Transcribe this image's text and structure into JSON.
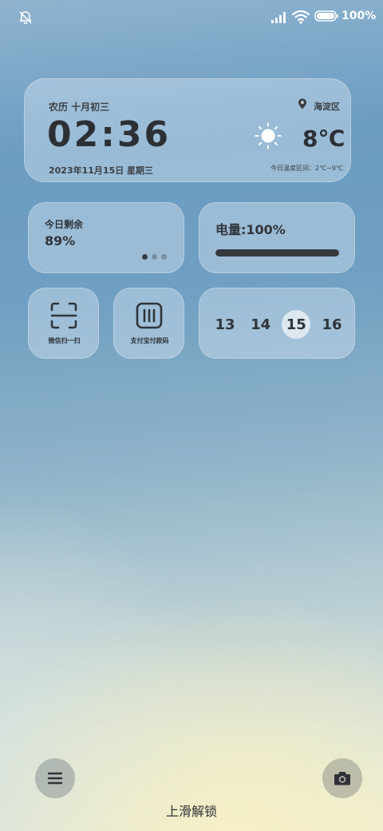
{
  "status_bar": {
    "battery_text": "100%",
    "icons": [
      "bell-off-icon",
      "signal-icon",
      "wifi-icon",
      "battery-icon"
    ]
  },
  "main_widget": {
    "lunar_date": "农历 十月初三",
    "time": "02:36",
    "date": "2023年11月15日 星期三",
    "location": "海淀区",
    "temperature": "8℃",
    "temp_range": "今日温度区间：2℃~9℃",
    "weather_icon": "sun-icon"
  },
  "remaining_widget": {
    "label": "今日剩余",
    "value": "89%",
    "page_count": 3,
    "active_page": 0
  },
  "battery_widget": {
    "label": "电量:100%",
    "level": 1.0
  },
  "shortcuts": [
    {
      "label": "微信扫一扫",
      "icon": "scan-icon"
    },
    {
      "label": "支付宝付款码",
      "icon": "barcode-icon"
    }
  ],
  "calendar_widget": {
    "days": [
      "13",
      "14",
      "15",
      "16"
    ],
    "today_index": 2
  },
  "bottom": {
    "unlock_text": "上滑解锁",
    "left_icon": "menu-icon",
    "right_icon": "camera-icon"
  },
  "colors": {
    "card_bg": "#dce8f2",
    "text_dark": "#2f3338",
    "battery_fill": "#35393e"
  }
}
